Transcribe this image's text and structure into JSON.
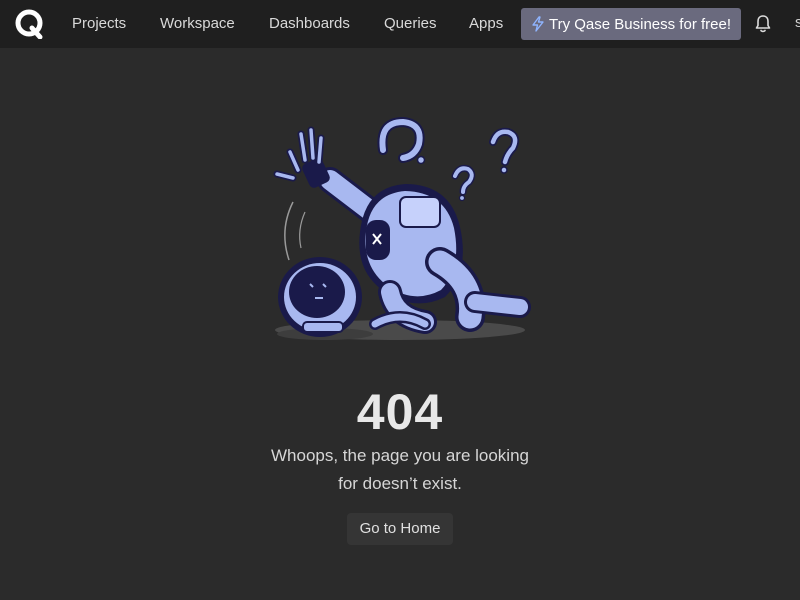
{
  "header": {
    "logo_icon": "qase-q-logo",
    "nav": [
      {
        "label": "Projects"
      },
      {
        "label": "Workspace"
      },
      {
        "label": "Dashboards"
      },
      {
        "label": "Queries"
      },
      {
        "label": "Apps"
      }
    ],
    "promo": {
      "label": "Try Qase Business for free!",
      "icon": "lightning-bolt-icon",
      "accent": "#6a6a7e"
    },
    "bell_icon": "bell-icon",
    "edge_glyph": "s"
  },
  "error": {
    "illustration": "fallen-robot-with-question-marks",
    "code": "404",
    "message_line1": "Whoops, the page you are looking",
    "message_line2": "for doesn’t exist.",
    "home_button": "Go to Home"
  },
  "colors": {
    "background": "#2b2b2b",
    "topbar": "#1f1f1f",
    "robot_primary": "#a8b8f0",
    "robot_dark": "#1a1a4a"
  }
}
